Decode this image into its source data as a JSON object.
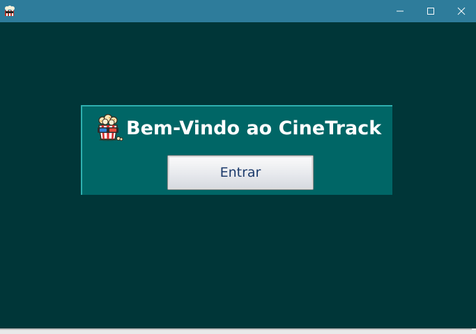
{
  "window": {
    "app_icon": "popcorn-3d-glasses-icon",
    "controls": {
      "minimize_icon": "minimize-icon",
      "maximize_icon": "maximize-icon",
      "close_icon": "close-icon"
    }
  },
  "welcome": {
    "icon": "popcorn-3d-glasses-icon",
    "title": "Bem-Vindo ao CineTrack",
    "enter_label": "Entrar"
  },
  "colors": {
    "title_bar": "#2e7c9b",
    "background": "#003638",
    "panel": "#006666",
    "panel_border": "#2fb0b0",
    "title_text": "#ffffff",
    "button_text": "#1b3a6b"
  }
}
